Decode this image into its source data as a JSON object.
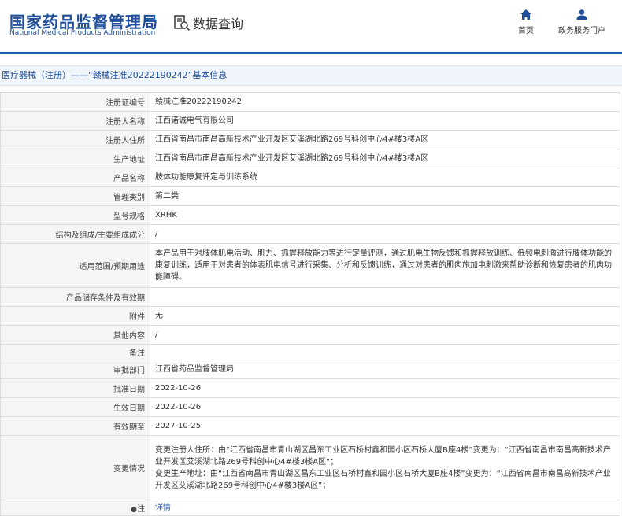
{
  "header": {
    "logo_cn": "国家药品监督管理局",
    "logo_en": "National Medical Products Administration",
    "query_label": "数据查询",
    "nav_home": "首页",
    "nav_gov": "政务服务门户"
  },
  "breadcrumb": "医疗器械（注册）——“赣械注准20222190242”基本信息",
  "rows": [
    {
      "label": "注册证编号",
      "value": "赣械注准20222190242"
    },
    {
      "label": "注册人名称",
      "value": "江西诺诚电气有限公司"
    },
    {
      "label": "注册人住所",
      "value": "江西省南昌市南昌高新技术产业开发区艾溪湖北路269号科创中心4#楼3楼A区"
    },
    {
      "label": "生产地址",
      "value": "江西省南昌市南昌高新技术产业开发区艾溪湖北路269号科创中心4#楼3楼A区"
    },
    {
      "label": "产品名称",
      "value": "肢体功能康复评定与训练系统"
    },
    {
      "label": "管理类别",
      "value": "第二类"
    },
    {
      "label": "型号规格",
      "value": "XRHK"
    },
    {
      "label": "结构及组成/主要组成成分",
      "value": "/"
    },
    {
      "label": "适用范围/预期用途",
      "value": "本产品用于对肢体肌电活动、肌力、抓握释放能力等进行定量评测，通过肌电生物反馈和抓握释放训练、低频电刺激进行肢体功能的康复训练，适用于对患者的体表肌电信号进行采集、分析和反馈训练，通过对患者的肌肉施加电刺激来帮助诊断和恢复患者的肌肉功能障碍。"
    },
    {
      "label": "产品储存条件及有效期",
      "value": ""
    },
    {
      "label": "附件",
      "value": "无"
    },
    {
      "label": "其他内容",
      "value": "/"
    },
    {
      "label": "备注",
      "value": ""
    },
    {
      "label": "审批部门",
      "value": "江西省药品监督管理局"
    },
    {
      "label": "批准日期",
      "value": "2022-10-26"
    },
    {
      "label": "生效日期",
      "value": "2022-10-26"
    },
    {
      "label": "有效期至",
      "value": "2027-10-25"
    },
    {
      "label": "变更情况",
      "value": "变更注册人住所：由“江西省南昌市青山湖区昌东工业区石桥村鑫和园小区石桥大厦B座4楼”变更为：“江西省南昌市南昌高新技术产业开发区艾溪湖北路269号科创中心4#楼3楼A区”；变更生产地址：由“江西省南昌市青山湖区昌东工业区石桥村鑫和园小区石桥大厦B座4楼”变更为：“江西省南昌市南昌高新技术产业开发区艾溪湖北路269号科创中心4#楼3楼A区”；"
    },
    {
      "label": "注",
      "value": "详情"
    }
  ],
  "change_lines": [
    "变更注册人住所：由“江西省南昌市青山湖区昌东工业区石桥村鑫和园小区石桥大厦B座4楼”变更为：“江西省南昌市南昌高新技术产业开发区艾溪湖北路269号科创中心4#楼3楼A区”；",
    "变更生产地址：由“江西省南昌市青山湖区昌东工业区石桥村鑫和园小区石桥大厦B座4楼”变更为：“江西省南昌市南昌高新技术产业开发区艾溪湖北路269号科创中心4#楼3楼A区”；"
  ],
  "colors": {
    "brand": "#1f4e9a",
    "accent": "#1f5db8"
  },
  "icons": {
    "query": "document-search-icon",
    "home": "home-icon",
    "user": "user-icon",
    "note": "pin-icon"
  }
}
